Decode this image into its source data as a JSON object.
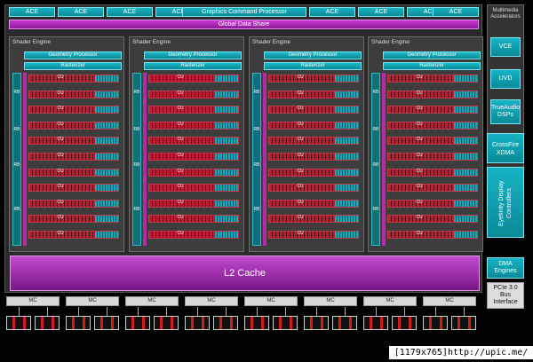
{
  "colors": {
    "ace": "#0a8a98",
    "gds": "#8e1a9a",
    "cu": "#b81f35",
    "l2": "#7a1688",
    "background": "#000000"
  },
  "top_bar": {
    "ace_labels": [
      "ACE",
      "ACE",
      "ACE",
      "ACE",
      "ACE",
      "ACE",
      "ACE",
      "ACE"
    ],
    "graphics_command_processor": "Graphics Command Processor",
    "global_data_share": "Global Data Share"
  },
  "shader_engines": [
    {
      "title": "Shader Engine",
      "geometry": "Geometry Processor",
      "rasterizer": "Rasterizer"
    },
    {
      "title": "Shader Engine",
      "geometry": "Geometry Processor",
      "rasterizer": "Rasterizer"
    },
    {
      "title": "Shader Engine",
      "geometry": "Geometry Processor",
      "rasterizer": "Rasterizer"
    },
    {
      "title": "Shader Engine",
      "geometry": "Geometry Processor",
      "rasterizer": "Rasterizer"
    }
  ],
  "cu_label": "CU",
  "rb_label": "RB",
  "l2_cache": "L2 Cache",
  "sidebar": {
    "multimedia": "Multimedia Accelerators",
    "vce": "VCE",
    "uvd": "UVD",
    "trueaudio": "TrueAudio DSPs",
    "crossfire": "CrossFire XDMA",
    "eyefinity": "Eyefinity Display Controllers",
    "dma": "DMA Engines",
    "pcie": "PCIe 3.0 Bus Interface"
  },
  "memory_controller_label": "MC",
  "watermark": "[1179x765]http://upic.me/"
}
